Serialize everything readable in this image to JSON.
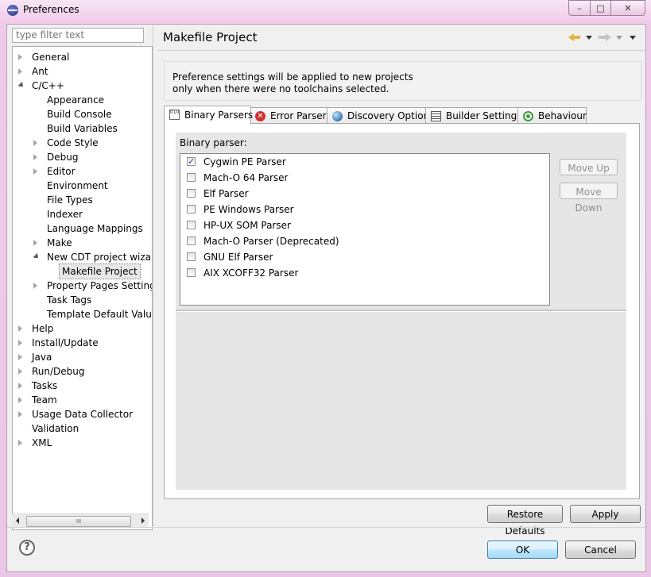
{
  "window": {
    "title": "Preferences",
    "minimize_glyph": "–",
    "maximize_glyph": "□",
    "close_glyph": "✕"
  },
  "filter": {
    "placeholder": "type filter text"
  },
  "tree": {
    "items": [
      {
        "label": "General",
        "level": 0,
        "expander": "closed"
      },
      {
        "label": "Ant",
        "level": 0,
        "expander": "closed"
      },
      {
        "label": "C/C++",
        "level": 0,
        "expander": "open"
      },
      {
        "label": "Appearance",
        "level": 1,
        "expander": "none"
      },
      {
        "label": "Build Console",
        "level": 1,
        "expander": "none"
      },
      {
        "label": "Build Variables",
        "level": 1,
        "expander": "none"
      },
      {
        "label": "Code Style",
        "level": 1,
        "expander": "closed"
      },
      {
        "label": "Debug",
        "level": 1,
        "expander": "closed"
      },
      {
        "label": "Editor",
        "level": 1,
        "expander": "closed"
      },
      {
        "label": "Environment",
        "level": 1,
        "expander": "none"
      },
      {
        "label": "File Types",
        "level": 1,
        "expander": "none"
      },
      {
        "label": "Indexer",
        "level": 1,
        "expander": "none"
      },
      {
        "label": "Language Mappings",
        "level": 1,
        "expander": "none"
      },
      {
        "label": "Make",
        "level": 1,
        "expander": "closed"
      },
      {
        "label": "New CDT project wizard",
        "level": 1,
        "expander": "open"
      },
      {
        "label": "Makefile Project",
        "level": 2,
        "expander": "none",
        "selected": true
      },
      {
        "label": "Property Pages Settings",
        "level": 1,
        "expander": "closed"
      },
      {
        "label": "Task Tags",
        "level": 1,
        "expander": "none"
      },
      {
        "label": "Template Default Values",
        "level": 1,
        "expander": "none"
      },
      {
        "label": "Help",
        "level": 0,
        "expander": "closed"
      },
      {
        "label": "Install/Update",
        "level": 0,
        "expander": "closed"
      },
      {
        "label": "Java",
        "level": 0,
        "expander": "closed"
      },
      {
        "label": "Run/Debug",
        "level": 0,
        "expander": "closed"
      },
      {
        "label": "Tasks",
        "level": 0,
        "expander": "closed"
      },
      {
        "label": "Team",
        "level": 0,
        "expander": "closed"
      },
      {
        "label": "Usage Data Collector",
        "level": 0,
        "expander": "closed"
      },
      {
        "label": "Validation",
        "level": 0,
        "expander": "none"
      },
      {
        "label": "XML",
        "level": 0,
        "expander": "closed"
      }
    ],
    "scroll_thumb": "III"
  },
  "page": {
    "title": "Makefile Project",
    "info_line1": "Preference settings will be applied to new projects",
    "info_line2": "only when there were no toolchains selected."
  },
  "tabs": [
    {
      "label": "Binary Parsers",
      "icon": "binary-icon",
      "active": true
    },
    {
      "label": "Error Parsers",
      "icon": "error-icon",
      "active": false
    },
    {
      "label": "Discovery Options",
      "icon": "globe-icon",
      "active": false
    },
    {
      "label": "Builder Settings",
      "icon": "builder-icon",
      "active": false
    },
    {
      "label": "Behaviour",
      "icon": "radio-icon",
      "active": false
    }
  ],
  "binary_parsers": {
    "group_label": "Binary parser:",
    "items": [
      {
        "label": "Cygwin PE Parser",
        "checked": true
      },
      {
        "label": "Mach-O 64 Parser",
        "checked": false
      },
      {
        "label": "Elf Parser",
        "checked": false
      },
      {
        "label": "PE Windows Parser",
        "checked": false
      },
      {
        "label": "HP-UX SOM Parser",
        "checked": false
      },
      {
        "label": "Mach-O Parser (Deprecated)",
        "checked": false
      },
      {
        "label": "GNU Elf Parser",
        "checked": false
      },
      {
        "label": "AIX XCOFF32 Parser",
        "checked": false
      }
    ],
    "move_up": "Move Up",
    "move_down": "Move Down"
  },
  "buttons": {
    "restore_defaults": "Restore Defaults",
    "apply": "Apply",
    "ok": "OK",
    "cancel": "Cancel",
    "help": "?"
  },
  "colors": {
    "accent": "#3c7fb1",
    "title_bar": "#f0cbe9"
  }
}
